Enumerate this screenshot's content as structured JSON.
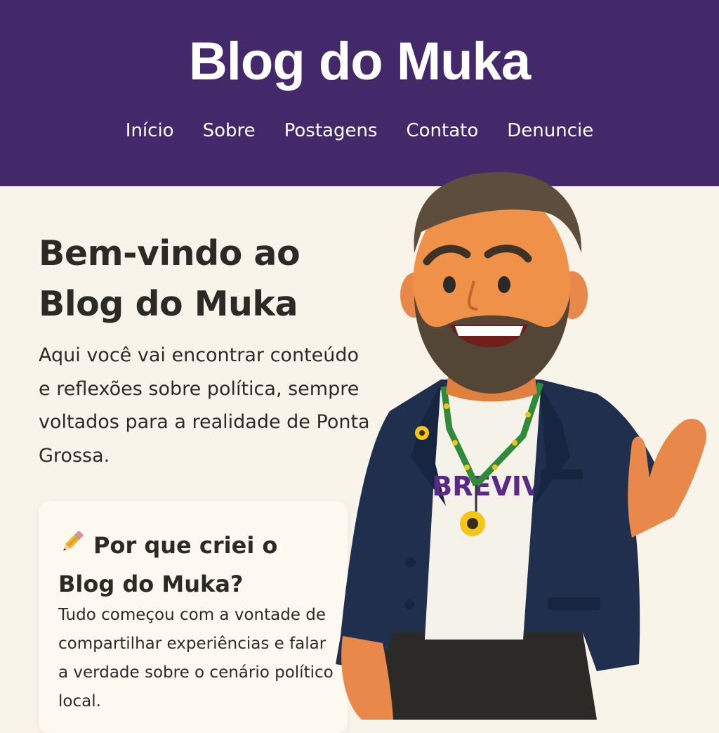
{
  "header": {
    "title": "Blog do Muka",
    "nav": [
      "Início",
      "Sobre",
      "Postagens",
      "Contato",
      "Denuncie"
    ]
  },
  "hero": {
    "title_line1": "Bem-vindo ao",
    "title_line2": "Blog do Muka",
    "text": "Aqui você vai encontrar conteúdo e reflexões sobre política, sempre voltados para a realidade de Ponta Grossa."
  },
  "card": {
    "icon": "pencil-icon",
    "title_line1": "Por que criei o",
    "title_line2": "Blog do Muka?",
    "text": "Tudo começou com a vontade de compartilhar experiências e falar a verdade sobre o cenário político local."
  },
  "illustration": {
    "shirt_text": "SOBREVIVE",
    "subject": "cartoon-man-waving"
  },
  "colors": {
    "header_bg": "#44296a",
    "page_bg": "#f9f4ea",
    "text_dark": "#2c2a27",
    "shirt_text": "#5b2a86",
    "jacket": "#1f2f4d"
  }
}
